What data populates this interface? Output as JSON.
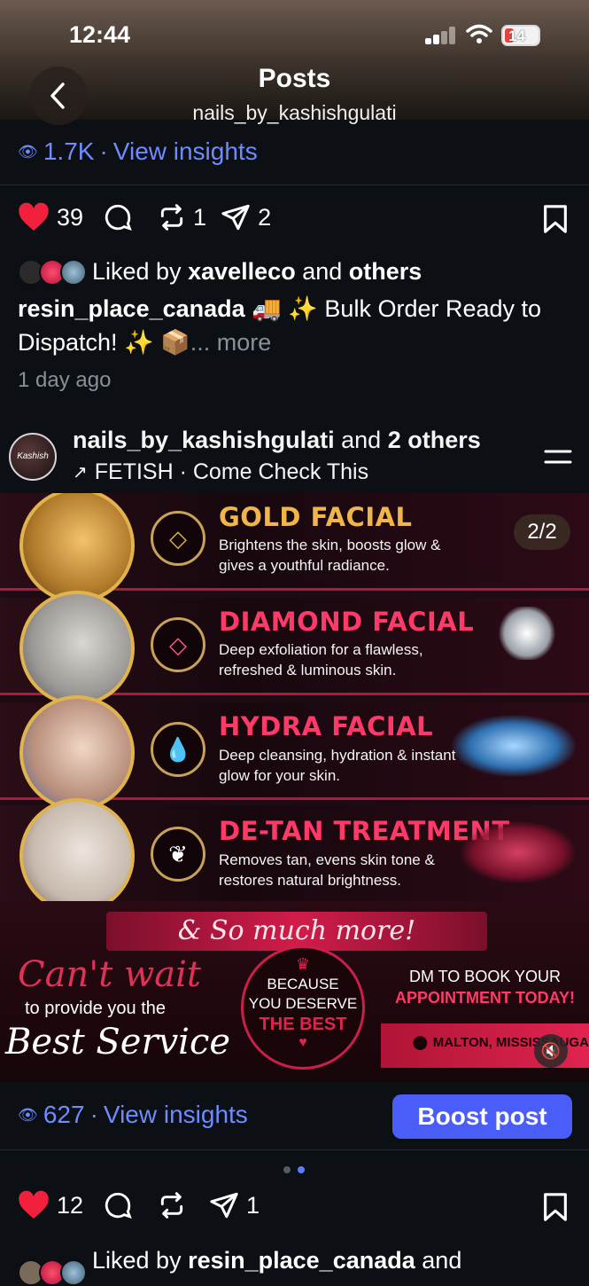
{
  "status": {
    "time": "12:44",
    "battery": "14"
  },
  "header": {
    "title": "Posts",
    "username": "nails_by_kashishgulati"
  },
  "post1": {
    "views": "1.7K",
    "view_insights": "View insights",
    "likes": "39",
    "reposts": "1",
    "shares": "2",
    "liked_by_prefix": "Liked by",
    "liked_by_user": "xavelleco",
    "liked_by_suffix": "and",
    "liked_by_others": "others",
    "caption_user": "resin_place_canada",
    "caption_text": "🚚 ✨ Bulk Order Ready to Dispatch! ✨ 📦",
    "caption_more": "... more",
    "time_ago": "1 day ago"
  },
  "post2": {
    "author": "nails_by_kashishgulati",
    "author_suffix": "and",
    "author_others": "2 others",
    "music": "FETISH · Come Check This",
    "carousel": "2/2",
    "services": [
      {
        "title": "GOLD FACIAL",
        "desc": "Brightens the skin, boosts glow & gives a youthful radiance.",
        "color": "#f0b64a"
      },
      {
        "title": "DIAMOND FACIAL",
        "desc": "Deep exfoliation for a flawless, refreshed & luminous skin.",
        "color": "#ff3a68"
      },
      {
        "title": "HYDRA FACIAL",
        "desc": "Deep cleansing, hydration & instant glow for your skin.",
        "color": "#ff3a68"
      },
      {
        "title": "DE-TAN TREATMENT",
        "desc": "Removes tan, evens skin tone & restores natural brightness.",
        "color": "#ff3a68"
      }
    ],
    "much_more": "& So much more!",
    "cant_wait": "Can't wait",
    "to_provide": "to provide you the",
    "best_service": "Best Service",
    "badge_line1": "BECAUSE",
    "badge_line2": "YOU DESERVE",
    "badge_line3": "THE BEST",
    "dm_line": "DM TO BOOK YOUR",
    "appt_line": "APPOINTMENT TODAY!",
    "location": "MALTON, MISSISSAUGA",
    "views": "627",
    "view_insights": "View insights",
    "boost": "Boost post",
    "likes": "12",
    "shares": "1",
    "liked_by_prefix": "Liked by",
    "liked_by_user": "resin_place_canada",
    "liked_by_suffix": "and"
  }
}
